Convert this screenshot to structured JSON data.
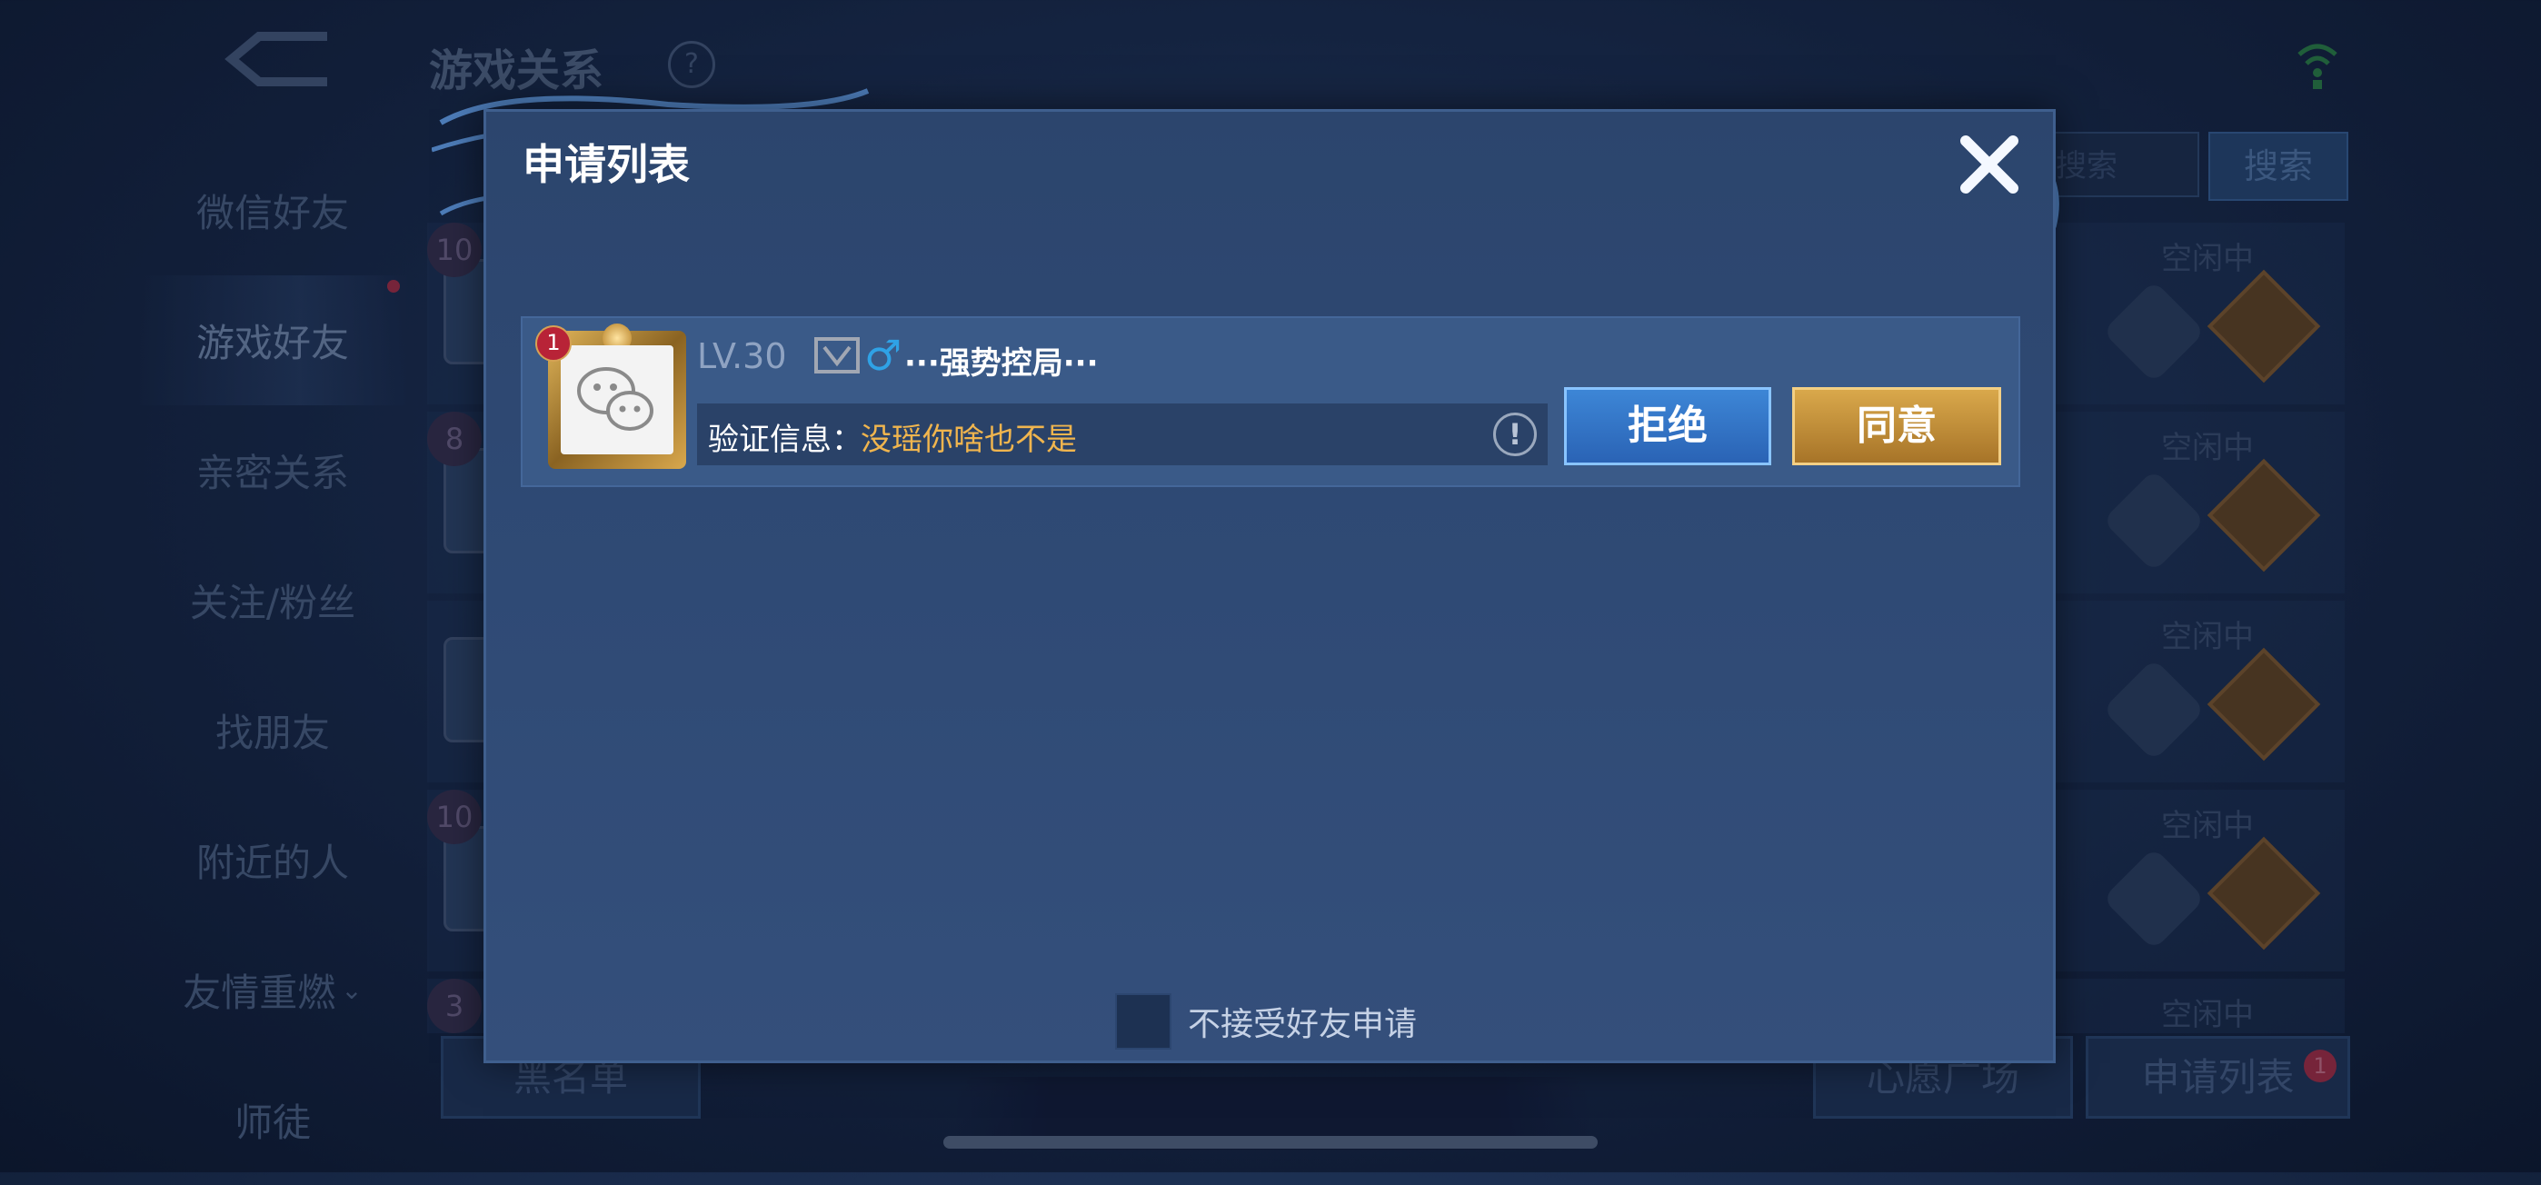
{
  "background": {
    "title": "游戏关系",
    "nav_items": [
      {
        "label": "微信好友"
      },
      {
        "label": "游戏好友"
      },
      {
        "label": "亲密关系"
      },
      {
        "label": "关注/粉丝"
      },
      {
        "label": "找朋友"
      },
      {
        "label": "附近的人"
      },
      {
        "label": "友情重燃"
      },
      {
        "label": "师徒"
      }
    ],
    "search_placeholder": "搜索",
    "search_button": "搜索",
    "friend_rows": [
      {
        "status": "空闲中",
        "level": "10"
      },
      {
        "status": "空闲中",
        "level": "8"
      },
      {
        "status": "空闲中",
        "level": ""
      },
      {
        "status": "空闲中",
        "level": "10"
      },
      {
        "status": "空闲中",
        "level": "3"
      }
    ],
    "blacklist_button": "黑名单",
    "wish_square_button": "心愿广场",
    "request_list_button": "申请列表",
    "request_badge": "1"
  },
  "dialog": {
    "title": "申请列表",
    "requests": [
      {
        "badge": "1",
        "level": "LV.30",
        "nickname": "···强势控局···",
        "verify_label": "验证信息：",
        "verify_message": "没瑶你啥也不是",
        "reject_label": "拒绝",
        "accept_label": "同意"
      }
    ],
    "reject_all_label": "不接受好友申请"
  },
  "colors": {
    "dialog_bg": "#2f4a75",
    "reject_button": "#3d86d6",
    "accept_button": "#d9a84b",
    "verify_message": "#f0b54e",
    "gender_male": "#2fa2e6"
  }
}
